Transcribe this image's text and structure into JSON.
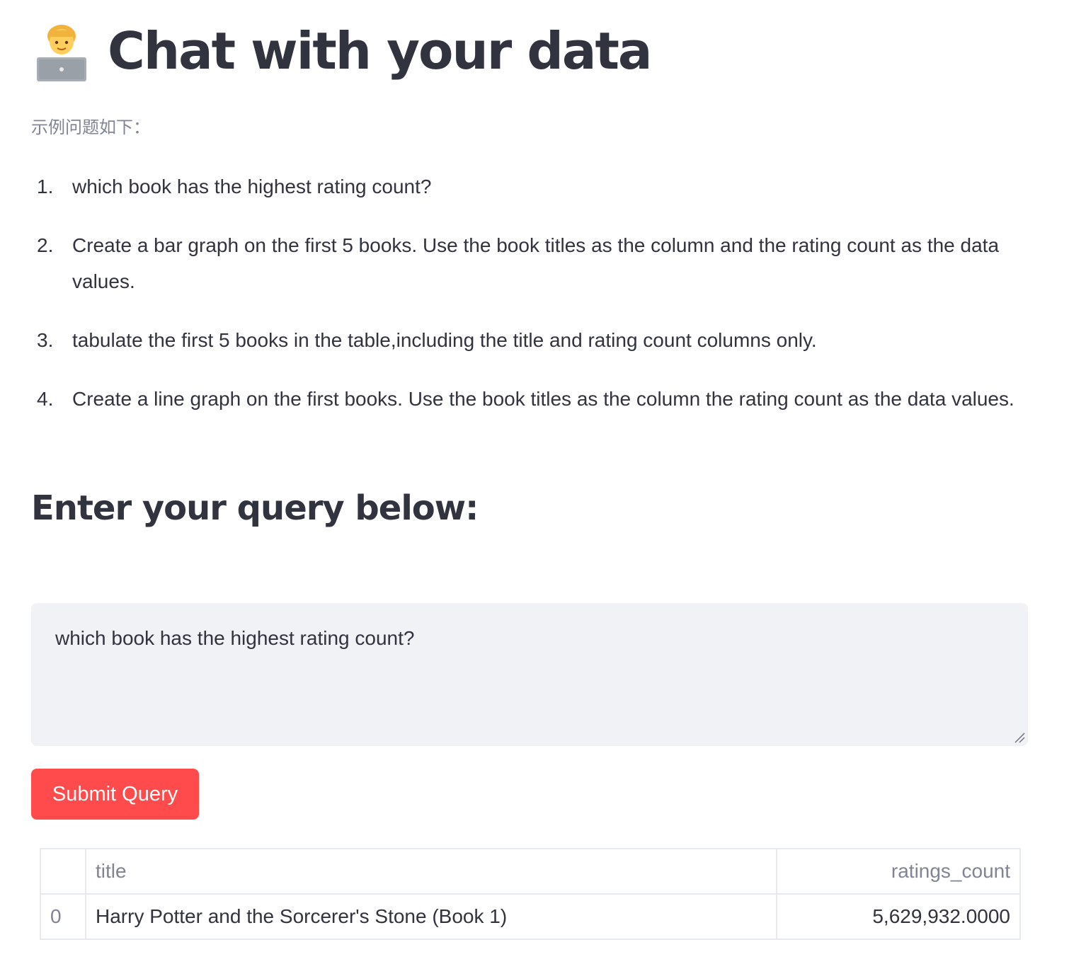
{
  "header": {
    "emoji_icon": "technologist-laptop-icon",
    "title": "Chat with your data"
  },
  "intro": {
    "subtitle": "示例问题如下："
  },
  "examples": [
    {
      "number": "1.",
      "text": "which book has the highest rating count?"
    },
    {
      "number": "2.",
      "text": "Create a bar graph on the first 5 books. Use the book titles as the column and the rating count as the data values."
    },
    {
      "number": "3.",
      "text": "tabulate the first 5 books in the table,including the title and rating count columns only."
    },
    {
      "number": "4.",
      "text": "Create a line graph on the first books. Use the book titles as the column the rating count as the data values."
    }
  ],
  "query_section": {
    "heading": "Enter your query below:",
    "input_value": "which book has the highest rating count?",
    "submit_label": "Submit Query",
    "submit_color": "#ff4b4b"
  },
  "result_table": {
    "columns": [
      "",
      "title",
      "ratings_count"
    ],
    "rows": [
      {
        "index": "0",
        "title": "Harry Potter and the Sorcerer's Stone (Book 1)",
        "ratings_count": "5,629,932.0000"
      }
    ]
  }
}
